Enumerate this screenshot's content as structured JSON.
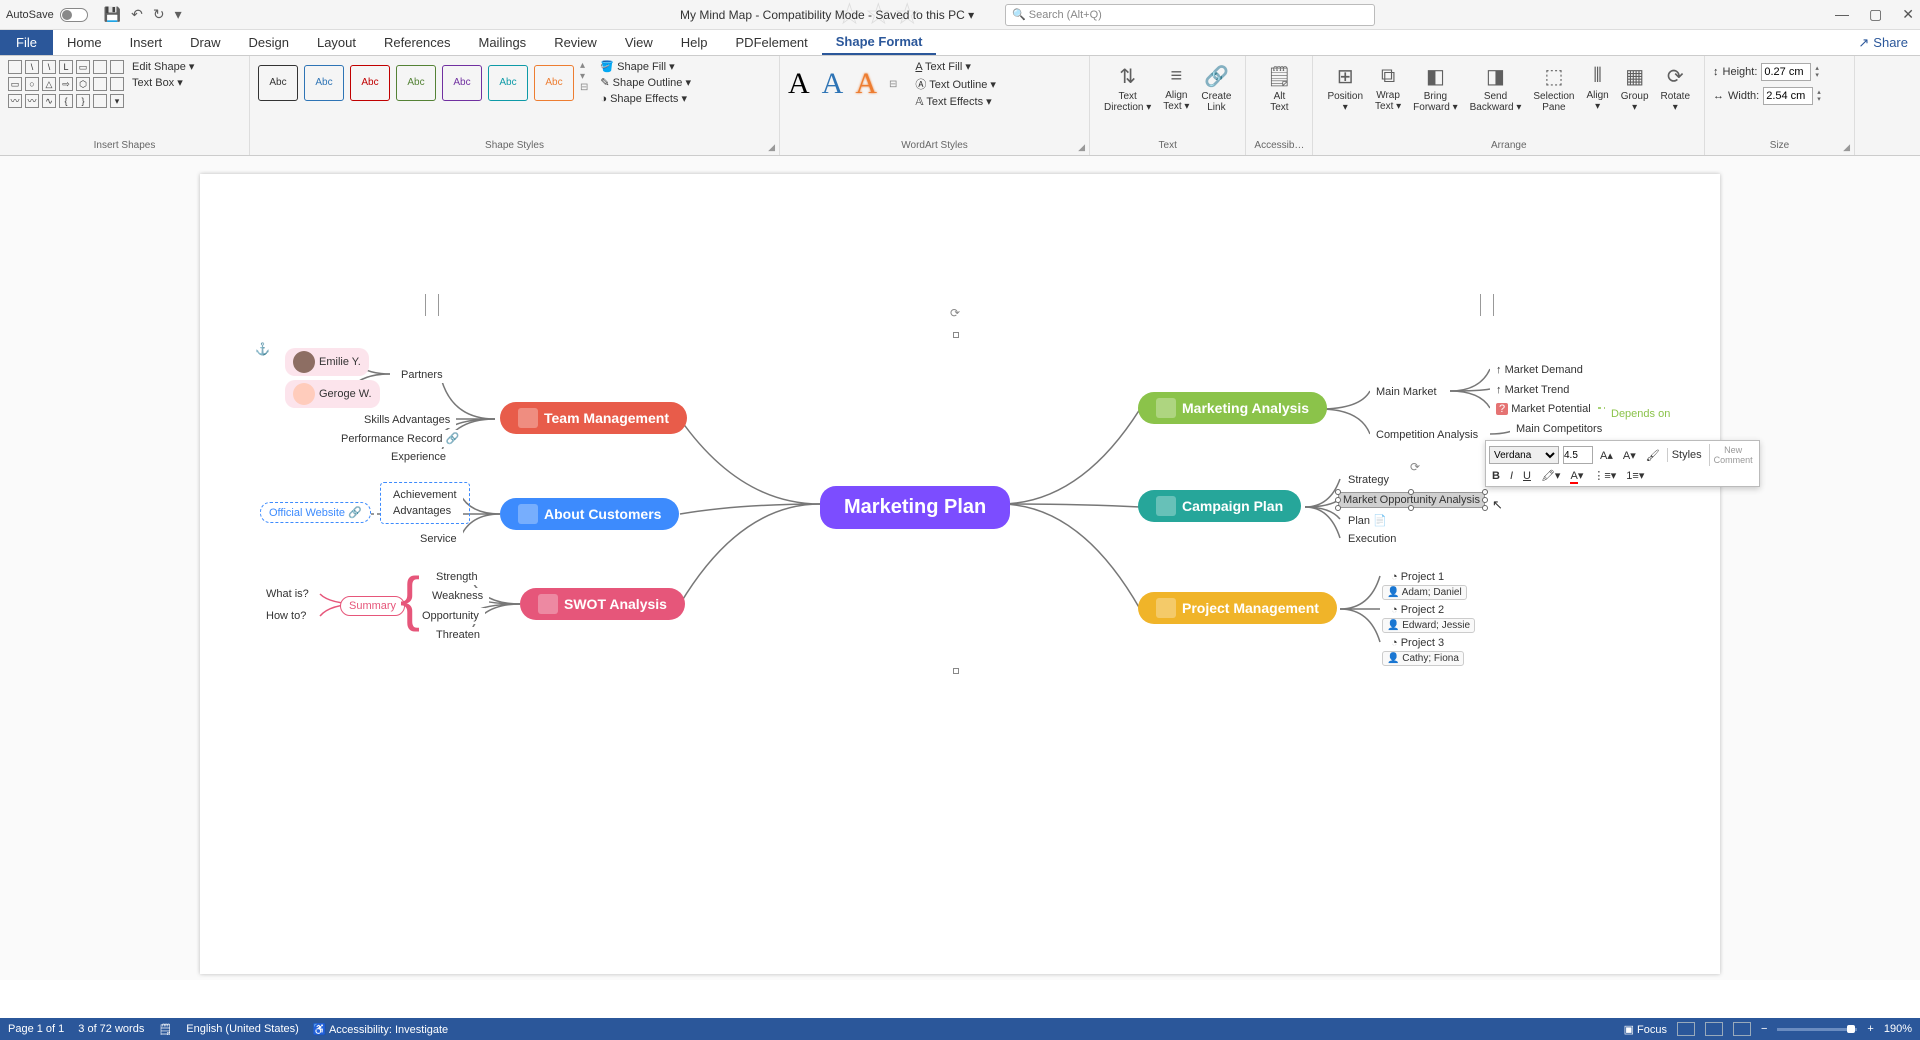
{
  "titlebar": {
    "autosave": "AutoSave",
    "toggle": "Off",
    "doc": "My Mind Map  -  Compatibility Mode  -  Saved to this PC ▾",
    "search_placeholder": "Search (Alt+Q)"
  },
  "tabs": {
    "file": "File",
    "items": [
      "Home",
      "Insert",
      "Draw",
      "Design",
      "Layout",
      "References",
      "Mailings",
      "Review",
      "View",
      "Help",
      "PDFelement",
      "Shape Format"
    ],
    "active": "Shape Format",
    "share": "Share"
  },
  "ribbon": {
    "insertShapes": {
      "label": "Insert Shapes",
      "editShape": "Edit Shape ▾",
      "textBox": "Text Box  ▾"
    },
    "shapeStyles": {
      "label": "Shape Styles",
      "abc": "Abc",
      "fill": "Shape Fill ▾",
      "outline": "Shape Outline ▾",
      "effects": "Shape Effects ▾"
    },
    "wordart": {
      "label": "WordArt Styles",
      "textFill": "Text Fill ▾",
      "textOutline": "Text Outline ▾",
      "textEffects": "Text Effects ▾"
    },
    "text": {
      "label": "Text",
      "direction": "Text\nDirection ▾",
      "align": "Align\nText ▾",
      "link": "Create\nLink"
    },
    "acc": {
      "label": "Accessib…",
      "alt": "Alt\nText"
    },
    "arrange": {
      "label": "Arrange",
      "position": "Position\n▾",
      "wrap": "Wrap\nText ▾",
      "forward": "Bring\nForward ▾",
      "backward": "Send\nBackward ▾",
      "selpane": "Selection\nPane",
      "align": "Align\n▾",
      "group": "Group\n▾",
      "rotate": "Rotate\n▾"
    },
    "size": {
      "label": "Size",
      "height_lbl": "Height:",
      "height": "0.27 cm",
      "width_lbl": "Width:",
      "width": "2.54 cm"
    }
  },
  "mindmap": {
    "center": "Marketing Plan",
    "left": {
      "team": {
        "label": "Team Management",
        "partners": "Partners",
        "emilie": "Emilie Y.",
        "george": "Geroge W.",
        "skills": "Skills Advantages",
        "perf": "Performance Record",
        "exp": "Experience"
      },
      "customers": {
        "label": "About Customers",
        "ach": "Achievement",
        "adv": "Advantages",
        "serv": "Service",
        "site": "Official Website"
      },
      "swot": {
        "label": "SWOT Analysis",
        "summary": "Summary",
        "what": "What is?",
        "how": "How to?",
        "str": "Strength",
        "wk": "Weakness",
        "opp": "Opportunity",
        "thr": "Threaten"
      }
    },
    "right": {
      "analysis": {
        "label": "Marketing Analysis",
        "main": "Main Market",
        "comp": "Competition Analysis",
        "demand": "Market Demand",
        "trend": "Market Trend",
        "potential": "Market Potential",
        "depends": "Depends on",
        "competitors": "Main Competitors"
      },
      "campaign": {
        "label": "Campaign Plan",
        "strategy": "Strategy",
        "moa": "Market Opportunity Analysis",
        "plan": "Plan",
        "exec": "Execution"
      },
      "project": {
        "label": "Project Management",
        "p1": "Project 1",
        "p1a": "Adam; Daniel",
        "p2": "Project 2",
        "p2a": "Edward; Jessie",
        "p3": "Project 3",
        "p3a": "Cathy; Fiona"
      }
    }
  },
  "miniToolbar": {
    "font": "Verdana",
    "size": "4.5",
    "styles": "Styles",
    "newComment": "New\nComment"
  },
  "status": {
    "page": "Page 1 of 1",
    "words": "3 of 72 words",
    "lang": "English (United States)",
    "acc": "Accessibility: Investigate",
    "focus": "Focus",
    "zoom": "190%"
  }
}
